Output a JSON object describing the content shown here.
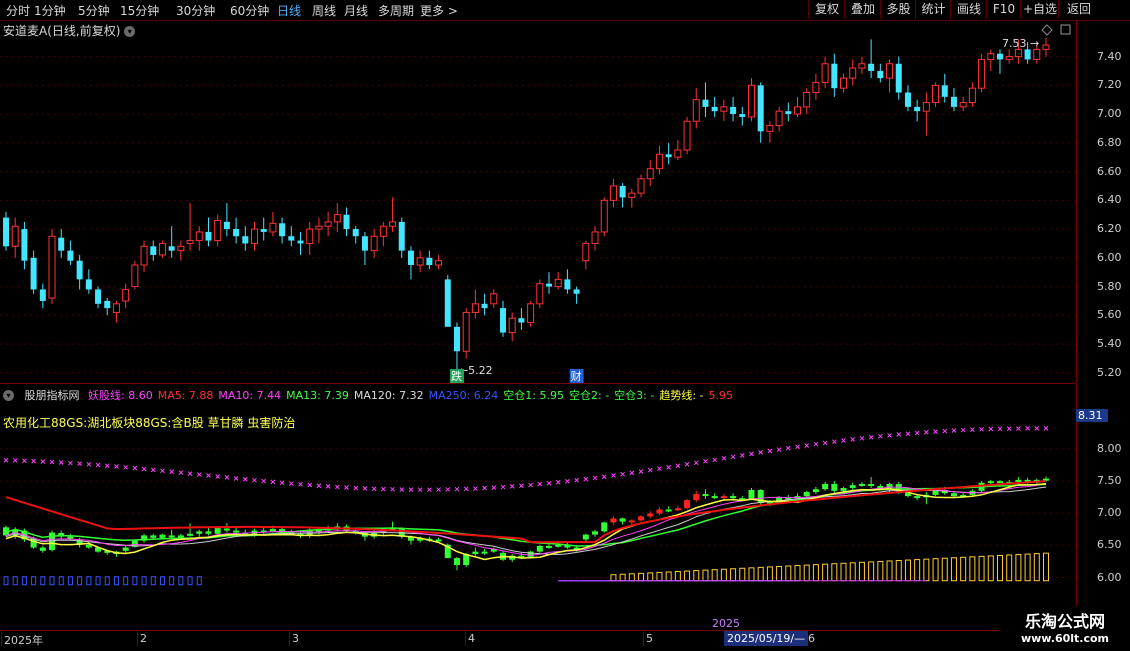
{
  "toolbar": {
    "periods": [
      "分时",
      "1分钟",
      "5分钟",
      "15分钟",
      "30分钟",
      "60分钟",
      "日线",
      "周线",
      "月线",
      "多周期",
      "更多 >"
    ],
    "active_period": "日线",
    "right_buttons": [
      "复权",
      "叠加",
      "多股",
      "统计",
      "画线",
      "F10",
      "+自选",
      "返回"
    ]
  },
  "main_title": "安道麦A(日线,前复权)",
  "price_axis": [
    "7.40",
    "7.20",
    "7.00",
    "6.80",
    "6.60",
    "6.40",
    "6.20",
    "6.00",
    "5.80",
    "5.60",
    "5.40",
    "5.20"
  ],
  "high_label": "7.53",
  "low_label": "5.22",
  "events": [
    {
      "text": "跌",
      "color": "#1fa35a"
    },
    {
      "text": "财",
      "color": "#1f5fd1"
    }
  ],
  "indicator": {
    "name": "股朋指标网",
    "legend": [
      {
        "label": "妖股线:",
        "value": "8.60",
        "color": "#ff44ff"
      },
      {
        "label": "MA5:",
        "value": "7.88",
        "color": "#ff3030"
      },
      {
        "label": "MA10:",
        "value": "7.44",
        "color": "#ff44ff"
      },
      {
        "label": "MA13:",
        "value": "7.39",
        "color": "#44ff44"
      },
      {
        "label": "MA120:",
        "value": "7.32",
        "color": "#dddddd"
      },
      {
        "label": "MA250:",
        "value": "6.24",
        "color": "#3355ff"
      },
      {
        "label": "空仓1:",
        "value": "5.95",
        "color": "#44ff44"
      },
      {
        "label": "空仓2:",
        "value": "-",
        "color": "#44ff44"
      },
      {
        "label": "空仓3:",
        "value": "-",
        "color": "#44ff44"
      },
      {
        "label": "趋势线:",
        "value": "-",
        "color": "#ffff44"
      },
      {
        "label": "",
        "value": "5.95",
        "color": "#ff3030"
      }
    ],
    "info_line": "农用化工88GS:湖北板块88GS:含B股 草甘膦 虫害防治",
    "axis": [
      "8.00",
      "7.50",
      "7.00",
      "6.50",
      "6.00"
    ],
    "current_value": "8.31"
  },
  "x_axis": {
    "labels": [
      {
        "text": "2025年",
        "color": "#cfcfcf"
      },
      {
        "text": "2",
        "color": "#cfcfcf"
      },
      {
        "text": "3",
        "color": "#cfcfcf"
      },
      {
        "text": "4",
        "color": "#cfcfcf"
      },
      {
        "text": "5",
        "color": "#cfcfcf"
      },
      {
        "text": "6",
        "color": "#cfcfcf"
      }
    ],
    "year_marker": "2025",
    "cursor_date": "2025/05/19/—"
  },
  "watermark": {
    "name": "乐淘公式网",
    "url": "www.60lt.com"
  },
  "colors": {
    "up": "#ff3333",
    "down": "#44e5ff",
    "frame": "#7a0000",
    "bg": "#000000"
  },
  "chart_data": {
    "type": "candlestick",
    "title": "安道麦A(日线,前复权)",
    "ylim": [
      5.15,
      7.55
    ],
    "ticks": [
      5.2,
      5.4,
      5.6,
      5.8,
      6.0,
      6.2,
      6.4,
      6.6,
      6.8,
      7.0,
      7.2,
      7.4
    ],
    "candles": [
      [
        6.28,
        6.32,
        6.05,
        6.08
      ],
      [
        6.08,
        6.28,
        6.0,
        6.22
      ],
      [
        6.2,
        6.25,
        5.92,
        5.98
      ],
      [
        6.0,
        6.05,
        5.75,
        5.78
      ],
      [
        5.78,
        5.82,
        5.65,
        5.7
      ],
      [
        5.72,
        6.2,
        5.68,
        6.15
      ],
      [
        6.14,
        6.2,
        6.0,
        6.05
      ],
      [
        6.05,
        6.12,
        5.95,
        5.98
      ],
      [
        5.98,
        6.02,
        5.78,
        5.85
      ],
      [
        5.85,
        5.92,
        5.75,
        5.78
      ],
      [
        5.78,
        5.8,
        5.65,
        5.68
      ],
      [
        5.7,
        5.72,
        5.6,
        5.65
      ],
      [
        5.62,
        5.7,
        5.55,
        5.68
      ],
      [
        5.7,
        5.82,
        5.65,
        5.78
      ],
      [
        5.8,
        5.98,
        5.78,
        5.95
      ],
      [
        5.95,
        6.12,
        5.9,
        6.08
      ],
      [
        6.08,
        6.12,
        5.98,
        6.02
      ],
      [
        6.02,
        6.12,
        6.0,
        6.1
      ],
      [
        6.08,
        6.22,
        6.0,
        6.05
      ],
      [
        6.05,
        6.12,
        5.98,
        6.08
      ],
      [
        6.1,
        6.38,
        6.05,
        6.12
      ],
      [
        6.12,
        6.22,
        6.05,
        6.18
      ],
      [
        6.18,
        6.28,
        6.08,
        6.12
      ],
      [
        6.12,
        6.3,
        6.08,
        6.26
      ],
      [
        6.25,
        6.38,
        6.15,
        6.2
      ],
      [
        6.2,
        6.28,
        6.1,
        6.15
      ],
      [
        6.15,
        6.22,
        6.05,
        6.1
      ],
      [
        6.1,
        6.25,
        6.05,
        6.2
      ],
      [
        6.2,
        6.28,
        6.12,
        6.18
      ],
      [
        6.18,
        6.32,
        6.15,
        6.24
      ],
      [
        6.24,
        6.28,
        6.1,
        6.15
      ],
      [
        6.15,
        6.22,
        6.08,
        6.12
      ],
      [
        6.12,
        6.18,
        6.02,
        6.1
      ],
      [
        6.1,
        6.25,
        6.02,
        6.2
      ],
      [
        6.2,
        6.28,
        6.1,
        6.22
      ],
      [
        6.22,
        6.32,
        6.15,
        6.25
      ],
      [
        6.25,
        6.38,
        6.18,
        6.3
      ],
      [
        6.3,
        6.35,
        6.15,
        6.2
      ],
      [
        6.2,
        6.22,
        6.1,
        6.15
      ],
      [
        6.15,
        6.18,
        5.95,
        6.05
      ],
      [
        6.05,
        6.2,
        6.0,
        6.15
      ],
      [
        6.15,
        6.25,
        6.08,
        6.22
      ],
      [
        6.22,
        6.42,
        6.18,
        6.25
      ],
      [
        6.25,
        6.28,
        6.0,
        6.05
      ],
      [
        6.05,
        6.08,
        5.85,
        5.95
      ],
      [
        5.95,
        6.05,
        5.9,
        6.0
      ],
      [
        6.0,
        6.05,
        5.92,
        5.95
      ],
      [
        5.95,
        6.02,
        5.92,
        5.98
      ],
      [
        5.85,
        5.88,
        5.55,
        5.52
      ],
      [
        5.52,
        5.55,
        5.22,
        5.35
      ],
      [
        5.35,
        5.65,
        5.3,
        5.62
      ],
      [
        5.62,
        5.78,
        5.58,
        5.68
      ],
      [
        5.68,
        5.75,
        5.6,
        5.65
      ],
      [
        5.68,
        5.78,
        5.65,
        5.75
      ],
      [
        5.65,
        5.7,
        5.45,
        5.48
      ],
      [
        5.48,
        5.62,
        5.42,
        5.58
      ],
      [
        5.58,
        5.65,
        5.5,
        5.55
      ],
      [
        5.55,
        5.7,
        5.52,
        5.68
      ],
      [
        5.68,
        5.85,
        5.65,
        5.82
      ],
      [
        5.82,
        5.9,
        5.75,
        5.8
      ],
      [
        5.8,
        5.9,
        5.78,
        5.85
      ],
      [
        5.85,
        5.92,
        5.75,
        5.78
      ],
      [
        5.78,
        5.8,
        5.68,
        5.75
      ],
      [
        5.98,
        6.12,
        5.92,
        6.1
      ],
      [
        6.1,
        6.22,
        6.05,
        6.18
      ],
      [
        6.18,
        6.42,
        6.15,
        6.4
      ],
      [
        6.4,
        6.55,
        6.35,
        6.5
      ],
      [
        6.5,
        6.52,
        6.35,
        6.42
      ],
      [
        6.42,
        6.48,
        6.35,
        6.45
      ],
      [
        6.45,
        6.58,
        6.42,
        6.55
      ],
      [
        6.55,
        6.68,
        6.5,
        6.62
      ],
      [
        6.62,
        6.78,
        6.58,
        6.72
      ],
      [
        6.72,
        6.8,
        6.65,
        6.7
      ],
      [
        6.7,
        6.82,
        6.68,
        6.75
      ],
      [
        6.75,
        6.98,
        6.72,
        6.95
      ],
      [
        6.95,
        7.18,
        6.9,
        7.1
      ],
      [
        7.1,
        7.22,
        6.98,
        7.05
      ],
      [
        7.05,
        7.12,
        6.98,
        7.02
      ],
      [
        7.02,
        7.1,
        6.95,
        7.05
      ],
      [
        7.05,
        7.12,
        6.95,
        7.0
      ],
      [
        7.0,
        7.05,
        6.92,
        6.98
      ],
      [
        6.98,
        7.25,
        6.95,
        7.2
      ],
      [
        7.2,
        7.22,
        6.8,
        6.88
      ],
      [
        6.88,
        6.95,
        6.8,
        6.92
      ],
      [
        6.92,
        7.05,
        6.88,
        7.02
      ],
      [
        7.02,
        7.08,
        6.95,
        7.0
      ],
      [
        7.0,
        7.12,
        6.98,
        7.05
      ],
      [
        7.05,
        7.18,
        7.0,
        7.15
      ],
      [
        7.15,
        7.28,
        7.1,
        7.22
      ],
      [
        7.22,
        7.4,
        7.18,
        7.35
      ],
      [
        7.35,
        7.42,
        7.12,
        7.18
      ],
      [
        7.18,
        7.28,
        7.15,
        7.25
      ],
      [
        7.25,
        7.38,
        7.2,
        7.32
      ],
      [
        7.32,
        7.4,
        7.28,
        7.35
      ],
      [
        7.35,
        7.52,
        7.25,
        7.3
      ],
      [
        7.3,
        7.35,
        7.22,
        7.25
      ],
      [
        7.25,
        7.38,
        7.15,
        7.35
      ],
      [
        7.35,
        7.4,
        7.1,
        7.15
      ],
      [
        7.15,
        7.2,
        7.02,
        7.05
      ],
      [
        7.05,
        7.1,
        6.95,
        7.02
      ],
      [
        7.02,
        7.15,
        6.85,
        7.08
      ],
      [
        7.08,
        7.22,
        7.05,
        7.2
      ],
      [
        7.2,
        7.28,
        7.08,
        7.12
      ],
      [
        7.12,
        7.18,
        7.02,
        7.05
      ],
      [
        7.05,
        7.12,
        7.02,
        7.08
      ],
      [
        7.08,
        7.22,
        7.05,
        7.18
      ],
      [
        7.18,
        7.42,
        7.15,
        7.38
      ],
      [
        7.38,
        7.45,
        7.3,
        7.42
      ],
      [
        7.42,
        7.45,
        7.28,
        7.38
      ],
      [
        7.38,
        7.45,
        7.35,
        7.4
      ],
      [
        7.4,
        7.52,
        7.35,
        7.45
      ],
      [
        7.45,
        7.5,
        7.35,
        7.38
      ],
      [
        7.38,
        7.48,
        7.35,
        7.45
      ],
      [
        7.45,
        7.53,
        7.4,
        7.48
      ]
    ],
    "indicator_ylim": [
      5.65,
      8.45
    ],
    "indicator_ticks": [
      6.0,
      6.5,
      7.0,
      7.5,
      8.0
    ]
  }
}
